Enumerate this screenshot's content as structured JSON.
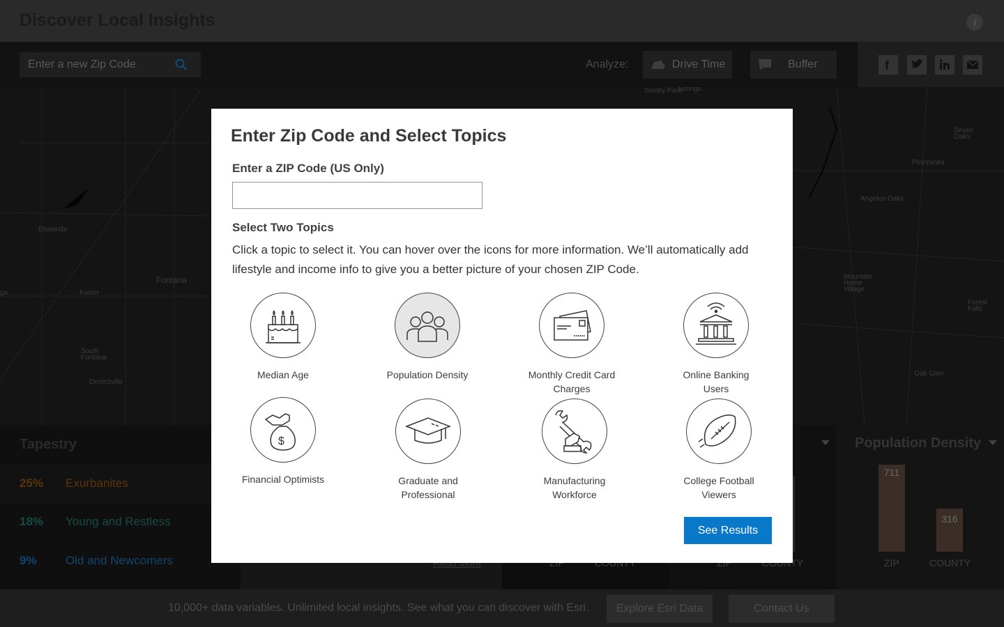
{
  "header": {
    "title": "Discover Local Insights",
    "info_glyph": "i"
  },
  "toolbar": {
    "search_placeholder": "Enter a new Zip Code",
    "analyze_label": "Analyze:",
    "drive_time_label": "Drive Time",
    "buffer_label": "Buffer"
  },
  "map": {
    "labels": [
      "Smiley Park",
      "Springs",
      "Seven Oaks",
      "Pinezanita",
      "Angelus Oaks",
      "Etiwanda",
      "Fontana",
      "Kaiser",
      "South Fontana",
      "Declezville",
      "Mountain Home Village",
      "Forest Falls",
      "Oak Glen",
      "ga"
    ]
  },
  "tapestry": {
    "title": "Tapestry",
    "rows": [
      {
        "pct": "25%",
        "name": "Exurbanites",
        "color": "#c46a10"
      },
      {
        "pct": "18%",
        "name": "Young and Restless",
        "color": "#1f8a7a"
      },
      {
        "pct": "9%",
        "name": "Old and Newcomers",
        "color": "#1b75b5"
      }
    ],
    "read_more": "Read More"
  },
  "charts": {
    "panel3": {
      "zip_label": "ZIP",
      "county_label": "COUNTY"
    },
    "panel4": {
      "zip_label": "ZIP",
      "county_label": "COUNTY"
    },
    "population_density": {
      "title": "Population Density",
      "zip_value": "711",
      "county_value": "316",
      "zip_label": "ZIP",
      "county_label": "COUNTY"
    }
  },
  "footer": {
    "text": "10,000+ data variables. Unlimited local insights. See what you can discover with Esri.",
    "explore_label": "Explore Esri Data",
    "contact_label": "Contact Us"
  },
  "modal": {
    "title": "Enter Zip Code and Select Topics",
    "zip_label": "Enter a ZIP Code (US Only)",
    "zip_value": "",
    "topics_label": "Select Two Topics",
    "topics_desc": "Click a topic to select it. You can hover over the icons for more information. We’ll automatically add lifestyle and income info to give you a better picture of your chosen ZIP Code.",
    "topics": [
      {
        "label": "Median Age",
        "icon": "birthday-cake-icon",
        "selected": false
      },
      {
        "label": "Population Density",
        "icon": "people-group-icon",
        "selected": true
      },
      {
        "label": "Monthly Credit Card Charges",
        "icon": "credit-cards-icon",
        "selected": false
      },
      {
        "label": "Online Banking Users",
        "icon": "online-bank-icon",
        "selected": false
      },
      {
        "label": "Financial Optimists",
        "icon": "money-bag-icon",
        "selected": false
      },
      {
        "label": "Graduate and Professional",
        "icon": "graduation-cap-icon",
        "selected": false
      },
      {
        "label": "Manufacturing Workforce",
        "icon": "wrench-hand-icon",
        "selected": false
      },
      {
        "label": "College Football Viewers",
        "icon": "football-icon",
        "selected": false
      }
    ],
    "submit_label": "See Results"
  },
  "colors": {
    "primary_button": "#0a78c8",
    "selected_topic": "#e6e6e6"
  }
}
